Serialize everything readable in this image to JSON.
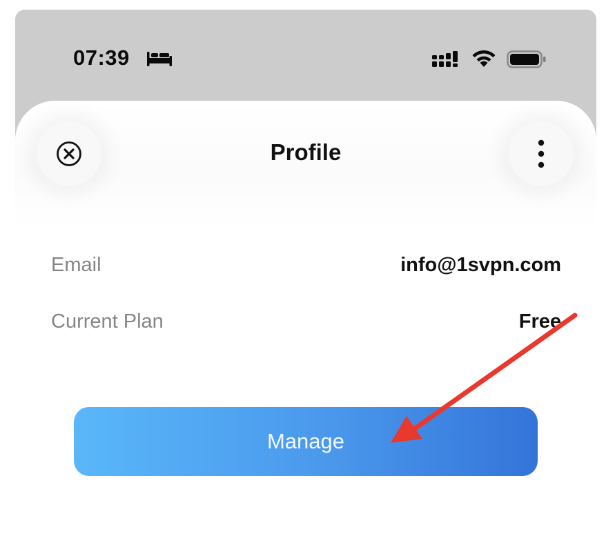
{
  "status_bar": {
    "time": "07:39",
    "icons": [
      "bed-icon",
      "cellular-signal-icon",
      "wifi-icon",
      "battery-icon"
    ]
  },
  "header": {
    "title": "Profile",
    "close_icon": "close-icon",
    "menu_icon": "more-vertical-icon"
  },
  "profile": {
    "rows": [
      {
        "label": "Email",
        "value": "info@1svpn.com"
      },
      {
        "label": "Current Plan",
        "value": "Free"
      }
    ]
  },
  "actions": {
    "manage_label": "Manage"
  },
  "colors": {
    "backdrop": "#cccccc",
    "button_gradient_start": "#5ab7f9",
    "button_gradient_end": "#3474d9",
    "annotation_arrow": "#e8392e"
  },
  "annotation": {
    "type": "arrow",
    "points_to": "manage-button"
  }
}
